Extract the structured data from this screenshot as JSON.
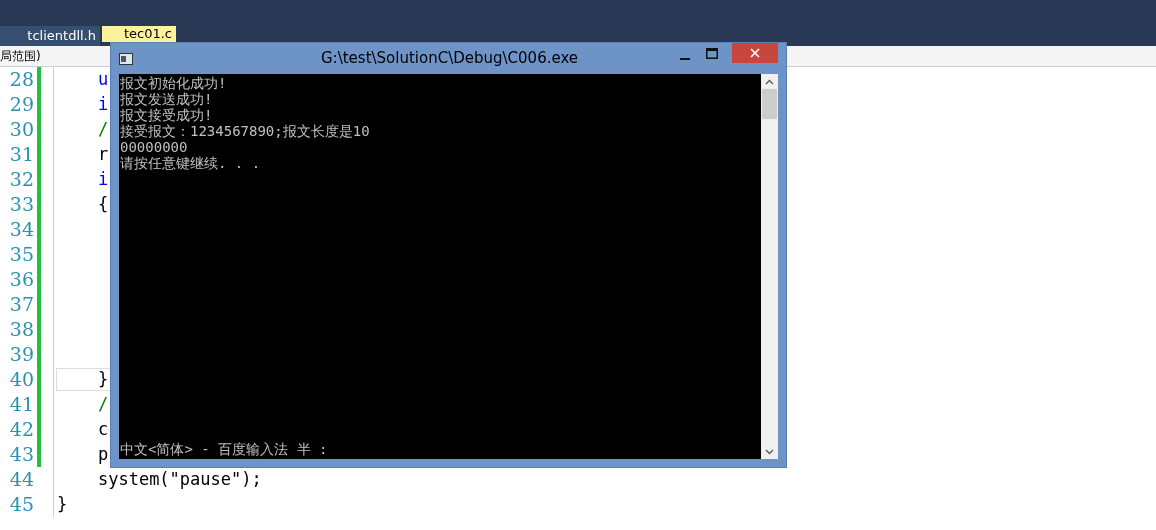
{
  "editor": {
    "tabs": [
      {
        "label": "tclientdll.h",
        "selected": false
      },
      {
        "label": "tec01.c",
        "selected": true
      }
    ],
    "scope": "局范围)",
    "lines": [
      {
        "number": "28",
        "code": "\tu",
        "color": "#0000ff",
        "changed": true,
        "current": false
      },
      {
        "number": "29",
        "code": "\ti",
        "color": "#0000ff",
        "changed": true,
        "current": false
      },
      {
        "number": "30",
        "code": "\t/",
        "color": "#008000",
        "changed": true,
        "current": false
      },
      {
        "number": "31",
        "code": "\tr",
        "color": "#000000",
        "changed": true,
        "current": false
      },
      {
        "number": "32",
        "code": "\ti",
        "color": "#0000ff",
        "changed": true,
        "current": false
      },
      {
        "number": "33",
        "code": "\t{",
        "color": "#000000",
        "changed": true,
        "current": false
      },
      {
        "number": "34",
        "changed": true,
        "current": false
      },
      {
        "number": "35",
        "changed": true,
        "current": false
      },
      {
        "number": "36",
        "changed": true,
        "current": false
      },
      {
        "number": "37",
        "changed": true,
        "current": false
      },
      {
        "number": "38",
        "changed": true,
        "current": false
      },
      {
        "number": "39",
        "changed": true,
        "current": false
      },
      {
        "number": "40",
        "code": "\t}",
        "color": "#000000",
        "changed": true,
        "current": true
      },
      {
        "number": "41",
        "code": "\t/",
        "color": "#008000",
        "changed": true,
        "current": false
      },
      {
        "number": "42",
        "code": "\tc",
        "color": "#000000",
        "changed": true,
        "current": false
      },
      {
        "number": "43",
        "code": "\tp",
        "color": "#000000",
        "changed": true,
        "current": false
      },
      {
        "number": "44",
        "code": "\tsystem(\"pause\");",
        "color": "#000000",
        "changed": false,
        "current": false
      },
      {
        "number": "45",
        "code": "}",
        "color": "#000000",
        "changed": false,
        "current": false
      }
    ]
  },
  "console": {
    "title": "G:\\test\\SolutionC\\Debug\\C006.exe",
    "output": [
      "报文初始化成功!",
      "报文发送成功!",
      "报文接受成功!",
      "接受报文：1234567890;报文长度是10",
      "00000000",
      "请按任意键继续. . ."
    ],
    "ime_status": "中文<简体> - 百度输入法 半 :"
  }
}
